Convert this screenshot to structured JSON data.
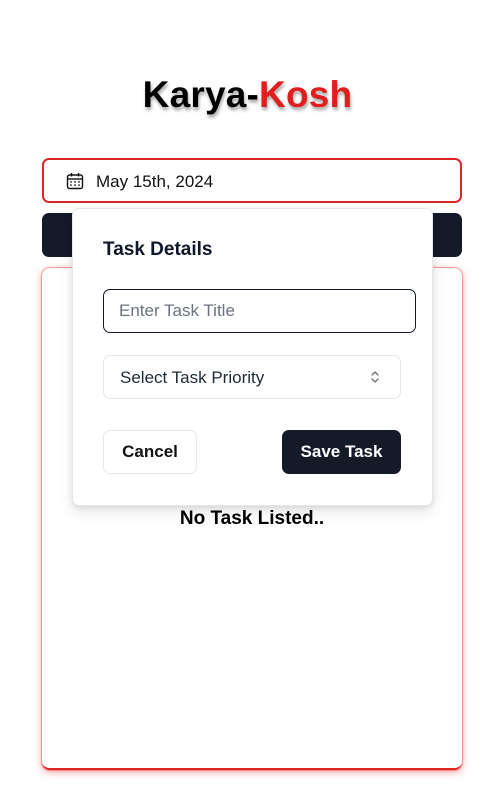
{
  "app": {
    "title_part1": "Karya-",
    "title_part2": "Kosh"
  },
  "date_picker": {
    "value": "May 15th, 2024",
    "icon": "calendar-icon"
  },
  "task_list": {
    "empty_message": "No Task Listed.."
  },
  "popover": {
    "heading": "Task Details",
    "title_input": {
      "value": "",
      "placeholder": "Enter Task Title"
    },
    "priority_select": {
      "label": "Select Task Priority",
      "icon": "chevron-up-down-icon"
    },
    "cancel_label": "Cancel",
    "save_label": "Save Task"
  },
  "colors": {
    "accent_red": "#dc2626",
    "dark": "#141a28"
  }
}
